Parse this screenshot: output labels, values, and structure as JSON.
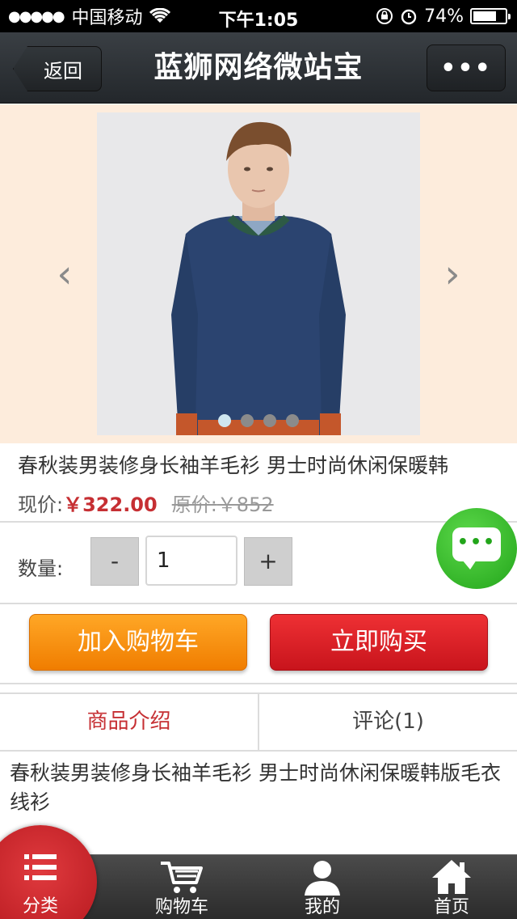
{
  "status_bar": {
    "signal": "●●●●●",
    "carrier": "中国移动",
    "time": "下午1:05",
    "battery": "74%",
    "battery_level": 0.74
  },
  "nav": {
    "back_label": "返回",
    "title": "蓝狮网络微站宝",
    "more_label": "•••"
  },
  "carousel": {
    "prev_label": "‹",
    "next_label": "›",
    "slide_count": 4,
    "active_index": 0
  },
  "product": {
    "title": "春秋装男装修身长袖羊毛衫 男士时尚休闲保暖韩",
    "current_price_label": "现价:",
    "current_price": "￥322.00",
    "original_price_label": "原价:",
    "original_price": "￥852"
  },
  "quantity": {
    "label": "数量:",
    "minus": "-",
    "value": "1",
    "plus": "+"
  },
  "chat": {
    "dots": "•••"
  },
  "actions": {
    "add_to_cart": "加入购物车",
    "buy_now": "立即购买"
  },
  "tabs": [
    {
      "label": "商品介绍",
      "active": true
    },
    {
      "label": "评论(1)",
      "active": false
    }
  ],
  "description": "春秋装男装修身长袖羊毛衫 男士时尚休闲保暖韩版毛衣线衫",
  "bottom_nav": {
    "category": "分类",
    "cart": "购物车",
    "mine": "我的",
    "home": "首页"
  },
  "colors": {
    "accent_red": "#c62f33",
    "cart_orange": "#f5901a",
    "chat_green": "#22a51a"
  }
}
